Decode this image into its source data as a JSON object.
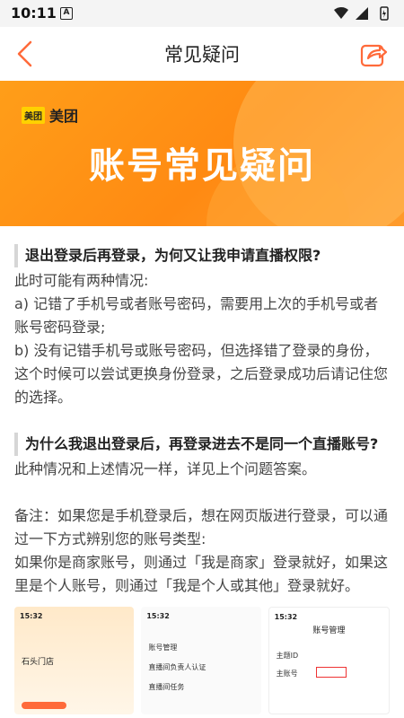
{
  "status_bar": {
    "time": "10:11",
    "badge": "A"
  },
  "navbar": {
    "title": "常见疑问"
  },
  "banner": {
    "brand_mark": "美团",
    "brand_name": "美团",
    "headline": "账号常见疑问"
  },
  "article": {
    "q1": "退出登录后再登录，为何又让我申请直播权限?",
    "q1_lines": [
      "此时可能有两种情况:",
      "a) 记错了手机号或者账号密码，需要用上次的手机号或者账号密码登录;",
      "b) 没有记错手机号或账号密码，但选择错了登录的身份，这个时候可以尝试更换身份登录，之后登录成功后请记住您的选择。"
    ],
    "q2": "为什么我退出登录后，再登录进去不是同一个直播账号?",
    "q2_answer": "此种情况和上述情况一样，详见上个问题答案。",
    "note_lines": [
      "备注：如果您是手机登录后，想在网页版进行登录，可以通过一下方式辨别您的账号类型:",
      "如果你是商家账号，则通过「我是商家」登录就好，如果这里是个人账号，则通过「我是个人或其他」登录就好。"
    ]
  },
  "thumbnails": [
    {
      "time": "15:32",
      "store": "石头门店"
    },
    {
      "time": "15:32",
      "rows": [
        "账号管理",
        "直播间负责人认证",
        "直播间任务"
      ]
    },
    {
      "time": "15:32",
      "header": "账号管理",
      "rows": [
        "主题ID",
        "主账号"
      ]
    }
  ],
  "colors": {
    "accent": "#ff6a3a",
    "banner": "#ff9e19"
  }
}
